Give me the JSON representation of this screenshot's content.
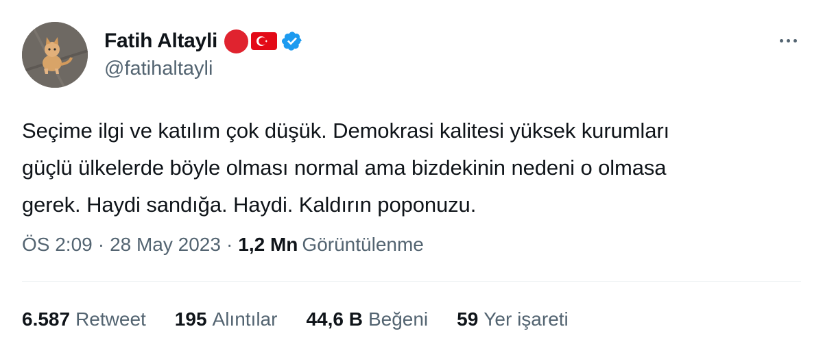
{
  "author": {
    "display_name": "Fatih Altayli",
    "handle": "@fatihaltayli",
    "avatar_icon": "cat-photo-avatar",
    "badges": [
      "red-circle-icon",
      "turkey-flag-icon",
      "verified-badge-icon"
    ],
    "verified_color": "#1d9bf0"
  },
  "more_icon": "more-horizontal-icon",
  "tweet": {
    "lines": [
      "Seçime ilgi ve katılım çok düşük. Demokrasi kalitesi yüksek kurumları",
      "güçlü ülkelerde böyle olması normal ama bizdekinin nedeni o olmasa",
      "gerek. Haydi sandığa. Haydi. Kaldırın poponuzu."
    ]
  },
  "meta": {
    "time": "ÖS 2:09",
    "separator": "·",
    "date": "28 May 2023",
    "views_count": "1,2 Mn",
    "views_label": "Görüntülenme"
  },
  "stats": [
    {
      "count": "6.587",
      "label": "Retweet"
    },
    {
      "count": "195",
      "label": "Alıntılar"
    },
    {
      "count": "44,6 B",
      "label": "Beğeni"
    },
    {
      "count": "59",
      "label": "Yer işareti"
    }
  ],
  "colors": {
    "text_primary": "#0f1419",
    "text_secondary": "#536471",
    "divider": "#eff3f4",
    "red_circle": "#e0232f",
    "flag_red": "#e30a17"
  }
}
